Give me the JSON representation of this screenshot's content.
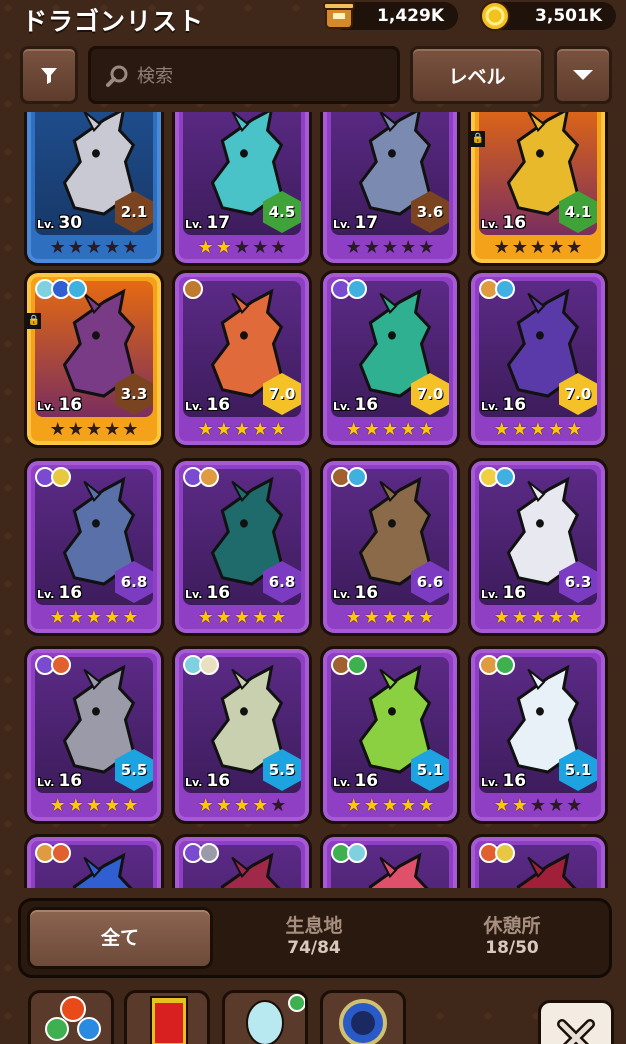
{
  "header": {
    "title": "ドラゴンリスト",
    "currency_a": {
      "value": "1,429K",
      "icon": "treasure-pot-icon"
    },
    "currency_b": {
      "value": "3,501K",
      "icon": "gold-coin-icon"
    }
  },
  "toolbar": {
    "filter_icon": "filter-icon",
    "search_placeholder": "検索",
    "search_value": "",
    "sort_label": "レベル",
    "dropdown_icon": "chevron-down-icon"
  },
  "cards": [
    {
      "lv_prefix": "Lv.",
      "level": "30",
      "rating": "2.1",
      "rating_color": "brown",
      "stars": 0,
      "rarity": "blue",
      "art": "#c9c9d4",
      "elements": [],
      "locked": false
    },
    {
      "lv_prefix": "Lv.",
      "level": "17",
      "rating": "4.5",
      "rating_color": "green",
      "stars": 2,
      "rarity": "purple",
      "art": "#49c2c8",
      "elements": [],
      "locked": false
    },
    {
      "lv_prefix": "Lv.",
      "level": "17",
      "rating": "3.6",
      "rating_color": "brown",
      "stars": 0,
      "rarity": "purple",
      "art": "#7b8ab0",
      "elements": [],
      "locked": false
    },
    {
      "lv_prefix": "Lv.",
      "level": "16",
      "rating": "4.1",
      "rating_color": "green",
      "stars": 0,
      "rarity": "gold",
      "art": "#e8b92a",
      "elements": [],
      "locked": true
    },
    {
      "lv_prefix": "Lv.",
      "level": "16",
      "rating": "3.3",
      "rating_color": "brown",
      "stars": 0,
      "rarity": "gold",
      "art": "#7a3b86",
      "elements": [
        "#7fd1e0",
        "#2f5fd0",
        "#3fb0e0"
      ],
      "locked": true
    },
    {
      "lv_prefix": "Lv.",
      "level": "16",
      "rating": "7.0",
      "rating_color": "yellow",
      "stars": 5,
      "rarity": "purple",
      "art": "#e06a3a",
      "elements": [
        "#c07a30"
      ],
      "locked": false
    },
    {
      "lv_prefix": "Lv.",
      "level": "16",
      "rating": "7.0",
      "rating_color": "yellow",
      "stars": 5,
      "rarity": "purple",
      "art": "#2fb090",
      "elements": [
        "#7a4ad0",
        "#3fb0e0"
      ],
      "locked": false
    },
    {
      "lv_prefix": "Lv.",
      "level": "16",
      "rating": "7.0",
      "rating_color": "yellow",
      "stars": 5,
      "rarity": "purple",
      "art": "#5a3aa8",
      "elements": [
        "#e09a40",
        "#3fb0e0"
      ],
      "locked": false
    },
    {
      "lv_prefix": "Lv.",
      "level": "16",
      "rating": "6.8",
      "rating_color": "violet",
      "stars": 5,
      "rarity": "purple",
      "art": "#5a70a8",
      "elements": [
        "#7a4ad0",
        "#e8c840"
      ],
      "locked": false
    },
    {
      "lv_prefix": "Lv.",
      "level": "16",
      "rating": "6.8",
      "rating_color": "violet",
      "stars": 5,
      "rarity": "purple",
      "art": "#1f6a6a",
      "elements": [
        "#7a4ad0",
        "#e09a40"
      ],
      "locked": false
    },
    {
      "lv_prefix": "Lv.",
      "level": "16",
      "rating": "6.6",
      "rating_color": "violet",
      "stars": 5,
      "rarity": "purple",
      "art": "#8a6a48",
      "elements": [
        "#a06030",
        "#3fb0e0"
      ],
      "locked": false
    },
    {
      "lv_prefix": "Lv.",
      "level": "16",
      "rating": "6.3",
      "rating_color": "violet",
      "stars": 5,
      "rarity": "purple",
      "art": "#e8e8f0",
      "elements": [
        "#f0d040",
        "#3fb0e0"
      ],
      "locked": false
    },
    {
      "lv_prefix": "Lv.",
      "level": "16",
      "rating": "5.5",
      "rating_color": "cyan",
      "stars": 5,
      "rarity": "purple",
      "art": "#9a9aa8",
      "elements": [
        "#7a4ad0",
        "#e06030"
      ],
      "locked": false
    },
    {
      "lv_prefix": "Lv.",
      "level": "16",
      "rating": "5.5",
      "rating_color": "cyan",
      "stars": 4,
      "rarity": "purple",
      "art": "#c8d0b0",
      "elements": [
        "#7fd1e0",
        "#e8e0c0"
      ],
      "locked": false
    },
    {
      "lv_prefix": "Lv.",
      "level": "16",
      "rating": "5.1",
      "rating_color": "cyan",
      "stars": 5,
      "rarity": "purple",
      "art": "#8ad040",
      "elements": [
        "#a06030",
        "#3fb050"
      ],
      "locked": false
    },
    {
      "lv_prefix": "Lv.",
      "level": "16",
      "rating": "5.1",
      "rating_color": "cyan",
      "stars": 2,
      "rarity": "purple",
      "art": "#e8f0f8",
      "elements": [
        "#e09a40",
        "#3fb050"
      ],
      "locked": false
    },
    {
      "lv_prefix": "",
      "level": "",
      "rating": "",
      "rating_color": "none",
      "stars": -1,
      "rarity": "purple",
      "art": "#2f5fd0",
      "elements": [
        "#e09a40",
        "#e06030"
      ],
      "locked": false
    },
    {
      "lv_prefix": "",
      "level": "",
      "rating": "",
      "rating_color": "none",
      "stars": -1,
      "rarity": "purple",
      "art": "#a02848",
      "elements": [
        "#7a4ad0",
        "#9a9aa8"
      ],
      "locked": false
    },
    {
      "lv_prefix": "",
      "level": "",
      "rating": "",
      "rating_color": "none",
      "stars": -1,
      "rarity": "purple",
      "art": "#e0506a",
      "elements": [
        "#3fb050",
        "#7fd1e0"
      ],
      "locked": false
    },
    {
      "lv_prefix": "",
      "level": "",
      "rating": "",
      "rating_color": "none",
      "stars": -1,
      "rarity": "purple",
      "art": "#a0203a",
      "elements": [
        "#e06030",
        "#e8c840"
      ],
      "locked": false
    }
  ],
  "tabs": [
    {
      "label": "全て",
      "count": ""
    },
    {
      "label": "生息地",
      "count": "74/84"
    },
    {
      "label": "休憩所",
      "count": "18/50"
    }
  ],
  "bottom_bar": {
    "items": [
      "element-orbs-icon",
      "card-deck-icon",
      "dragon-egg-icon",
      "portal-icon"
    ],
    "close_icon": "close-icon"
  }
}
